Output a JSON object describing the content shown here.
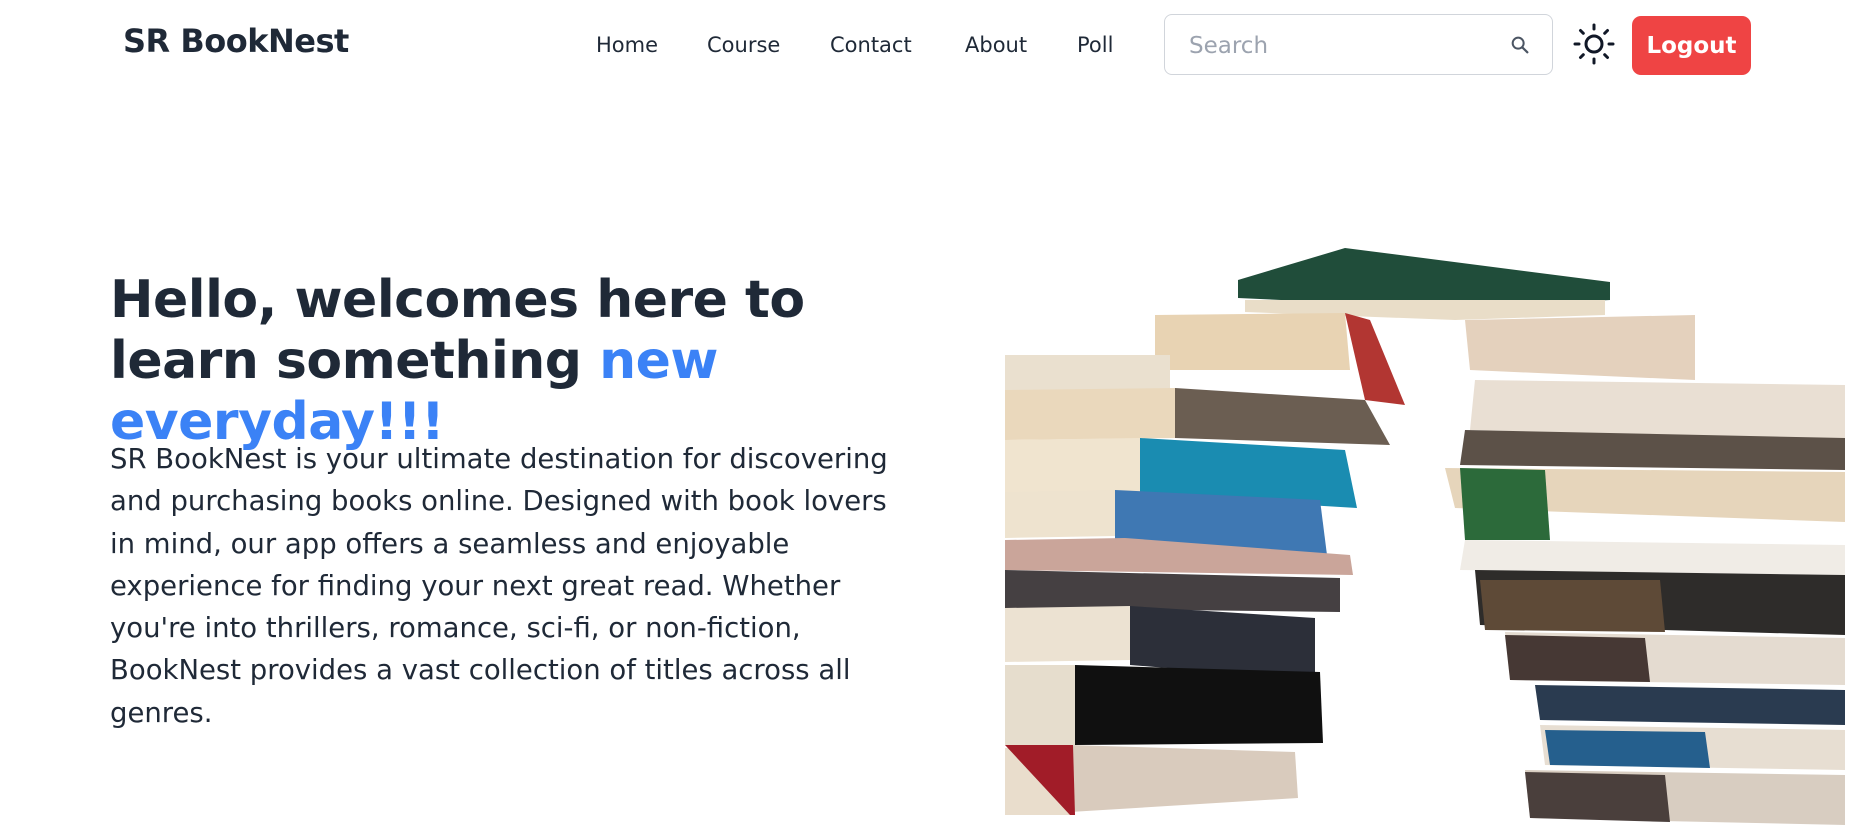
{
  "nav": {
    "brand": "SR BookNest",
    "links": [
      "Home",
      "Course",
      "Contact",
      "About",
      "Poll"
    ],
    "search": {
      "placeholder": "Search",
      "value": ""
    },
    "theme_icon": "sun-icon",
    "logout_label": "Logout"
  },
  "hero": {
    "title_main": "Hello, welcomes here to learn something ",
    "title_accent": "new everyday!!!",
    "body": "SR BookNest is your ultimate destination for discovering and purchasing books online. Designed with book lovers in mind, our app offers a seamless and enjoyable experience for finding your next great read. Whether you're into thrillers, romance, sci-fi, or non-fiction, BookNest provides a vast collection of titles across all genres.",
    "image_icon": "book-stack-illustration"
  },
  "colors": {
    "accent": "#3b82f6",
    "logout": "#ef4444",
    "text": "#1f2937"
  }
}
